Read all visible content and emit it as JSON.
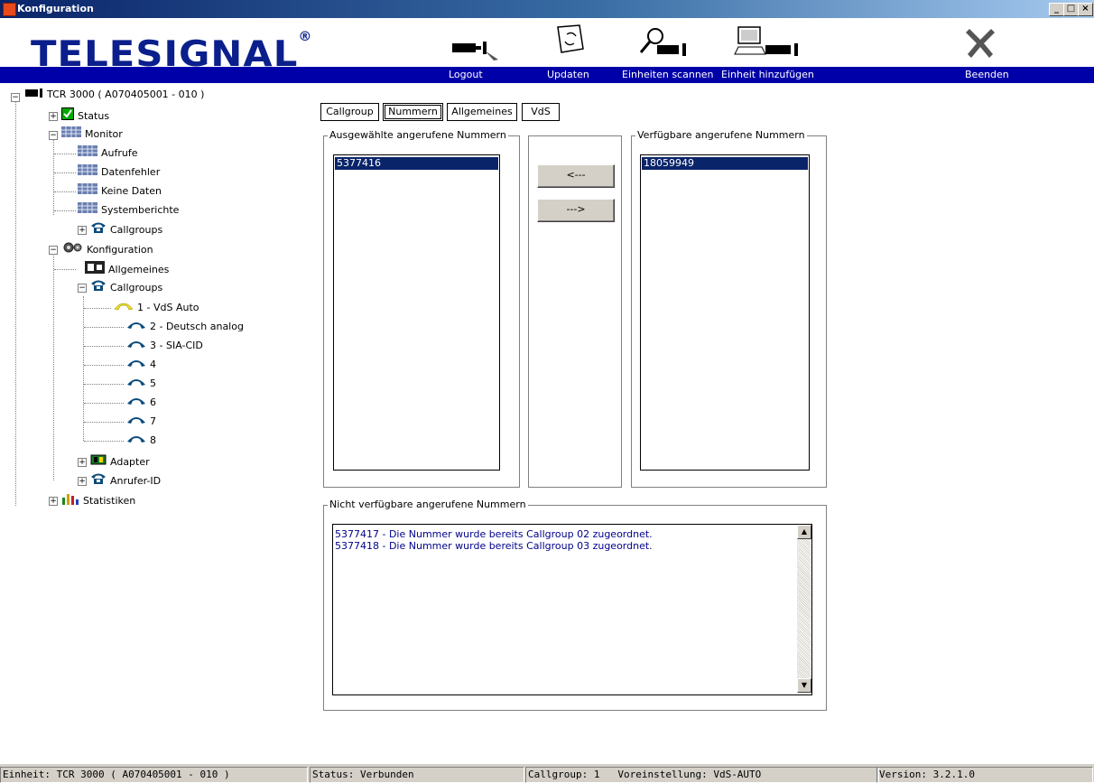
{
  "window": {
    "title": "Konfiguration"
  },
  "toolbar": {
    "logo": "TELESIGNAL",
    "logo_mark": "®",
    "buttons": [
      {
        "label": "Logout",
        "icon": "logout-icon"
      },
      {
        "label": "Updaten",
        "icon": "update-icon"
      },
      {
        "label": "Einheiten scannen",
        "icon": "scan-units-icon"
      },
      {
        "label": "Einheit hinzufügen",
        "icon": "add-unit-icon"
      },
      {
        "label": "Beenden",
        "icon": "exit-x-icon"
      }
    ]
  },
  "tree": {
    "root": "TCR 3000 ( A070405001 - 010 )",
    "nodes": {
      "status": "Status",
      "monitor": "Monitor",
      "aufrufe": "Aufrufe",
      "datenfehler": "Datenfehler",
      "keine_daten": "Keine Daten",
      "systemberichte": "Systemberichte",
      "monitor_callgroups": "Callgroups",
      "konfiguration": "Konfiguration",
      "allgemeines": "Allgemeines",
      "callgroups": "Callgroups",
      "cg1": "1 - VdS Auto",
      "cg2": "2 - Deutsch analog",
      "cg3": "3 - SIA-CID",
      "cg4": "4",
      "cg5": "5",
      "cg6": "6",
      "cg7": "7",
      "cg8": "8",
      "adapter": "Adapter",
      "anrufer_id": "Anrufer-ID",
      "statistiken": "Statistiken"
    }
  },
  "tabs": [
    "Callgroup",
    "Nummern",
    "Allgemeines",
    "VdS"
  ],
  "active_tab": "Nummern",
  "selected_numbers": {
    "legend": "Ausgewählte angerufene Nummern",
    "items": [
      "5377416"
    ]
  },
  "available_numbers": {
    "legend": "Verfügbare angerufene Nummern",
    "items": [
      "18059949"
    ]
  },
  "move_buttons": {
    "left": "<---",
    "right": "--->"
  },
  "unavailable_numbers": {
    "legend": "Nicht verfügbare angerufene Nummern",
    "lines": [
      "5377417 - Die Nummer wurde bereits Callgroup 02 zugeordnet.",
      "5377418 - Die Nummer wurde bereits Callgroup 03 zugeordnet."
    ]
  },
  "statusbar": {
    "unit": "Einheit: TCR 3000 ( A070405001 - 010 )",
    "status": "Status: Verbunden",
    "callgroup": "Callgroup: 1",
    "preset": "Voreinstellung: VdS-AUTO",
    "version": "Version: 3.2.1.0"
  },
  "colors": {
    "titlebar": "#0a246a",
    "accent_bar": "#0000a8",
    "logo": "#0b1f8c",
    "selection": "#0a246a",
    "message_text": "#00008a"
  }
}
